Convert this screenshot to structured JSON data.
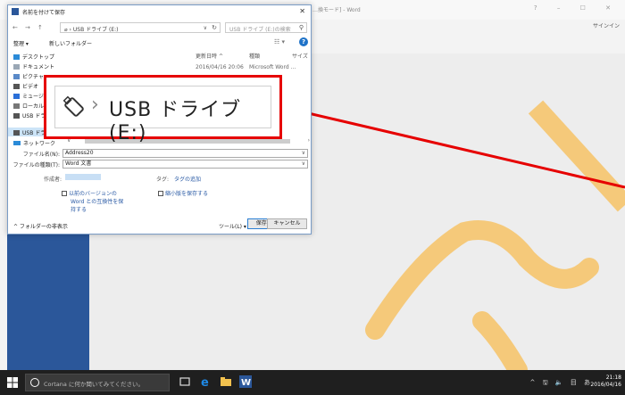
{
  "word": {
    "title": "…換モード] - Word",
    "controls": [
      "?",
      "–",
      "☐",
      "✕"
    ],
    "signin": "サインイン"
  },
  "dialog": {
    "title": "名前を付けて保存",
    "close": "✕",
    "nav": {
      "back": "←",
      "forward": "→",
      "up": "↑"
    },
    "address": {
      "separator": "›",
      "location": "USB ドライブ (E:)",
      "dropdown": "∨",
      "refresh": "↻"
    },
    "search": {
      "placeholder": "USB ドライブ (E:)の検索",
      "icon": "⚲"
    },
    "commands": {
      "organize": "整理 ▾",
      "new_folder": "新しいフォルダー",
      "view": "☷ ▾",
      "help": "?"
    },
    "nav_pane": [
      {
        "label": "デスクトップ",
        "color": "#2b8bd8"
      },
      {
        "label": "ドキュメント",
        "color": "#9aa7b5"
      },
      {
        "label": "ピクチャ",
        "color": "#5a8ac8"
      },
      {
        "label": "ビデオ",
        "color": "#555555"
      },
      {
        "label": "ミュージック",
        "color": "#2b6fd8"
      },
      {
        "label": "ローカル ディスク (C:)",
        "color": "#777777"
      },
      {
        "label": "USB ドライブ (E:)",
        "color": "#555555"
      }
    ],
    "nav_selected": "USB ドライブ (E:)",
    "network": "ネットワーク",
    "columns": {
      "modified": "更新日時",
      "sort_arrow": "^",
      "type": "種類",
      "size": "サイズ"
    },
    "file_row": {
      "modified": "2016/04/16 20:06",
      "type": "Microsoft Word ..."
    },
    "scroll": {
      "left": "∨",
      "right": "›"
    },
    "filename_label": "ファイル名(N):",
    "filename_value": "Address20",
    "filetype_label": "ファイルの種類(T):",
    "filetype_value": "Word 文書",
    "author_label": "作成者:",
    "author_value": "",
    "tags_label": "タグ:",
    "tags_value": "タグの追加",
    "checkbox_compat": [
      "以前のバージョンの",
      "Word との互換性を保",
      "持する"
    ],
    "checkbox_thumb": "縮小版を保存する",
    "hide_folders": "^ フォルダーの非表示",
    "tools": "ツール(L)  ▾",
    "save": "保存(S)",
    "cancel": "キャンセル"
  },
  "callout": {
    "chevron": "›",
    "text": "USB ドライブ (E:)",
    "border_color": "#e60000"
  },
  "taskbar": {
    "cortana_placeholder": "Cortana に何か聞いてみてください。",
    "tray": "^ 🖫 🔈 目 あ",
    "time": "21:18",
    "date": "2016/04/16"
  },
  "colors": {
    "accent_red": "#e60000",
    "word_blue": "#2b579a",
    "highlight_yellow": "#f5c97a"
  }
}
